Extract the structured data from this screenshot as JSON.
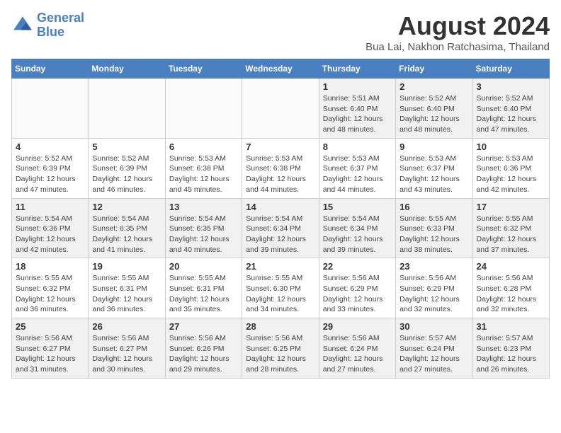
{
  "header": {
    "logo_line1": "General",
    "logo_line2": "Blue",
    "main_title": "August 2024",
    "subtitle": "Bua Lai, Nakhon Ratchasima, Thailand"
  },
  "weekdays": [
    "Sunday",
    "Monday",
    "Tuesday",
    "Wednesday",
    "Thursday",
    "Friday",
    "Saturday"
  ],
  "weeks": [
    [
      {
        "day": "",
        "info": "",
        "empty": true
      },
      {
        "day": "",
        "info": "",
        "empty": true
      },
      {
        "day": "",
        "info": "",
        "empty": true
      },
      {
        "day": "",
        "info": "",
        "empty": true
      },
      {
        "day": "1",
        "info": "Sunrise: 5:51 AM\nSunset: 6:40 PM\nDaylight: 12 hours\nand 48 minutes."
      },
      {
        "day": "2",
        "info": "Sunrise: 5:52 AM\nSunset: 6:40 PM\nDaylight: 12 hours\nand 48 minutes."
      },
      {
        "day": "3",
        "info": "Sunrise: 5:52 AM\nSunset: 6:40 PM\nDaylight: 12 hours\nand 47 minutes."
      }
    ],
    [
      {
        "day": "4",
        "info": "Sunrise: 5:52 AM\nSunset: 6:39 PM\nDaylight: 12 hours\nand 47 minutes."
      },
      {
        "day": "5",
        "info": "Sunrise: 5:52 AM\nSunset: 6:39 PM\nDaylight: 12 hours\nand 46 minutes."
      },
      {
        "day": "6",
        "info": "Sunrise: 5:53 AM\nSunset: 6:38 PM\nDaylight: 12 hours\nand 45 minutes."
      },
      {
        "day": "7",
        "info": "Sunrise: 5:53 AM\nSunset: 6:38 PM\nDaylight: 12 hours\nand 44 minutes."
      },
      {
        "day": "8",
        "info": "Sunrise: 5:53 AM\nSunset: 6:37 PM\nDaylight: 12 hours\nand 44 minutes."
      },
      {
        "day": "9",
        "info": "Sunrise: 5:53 AM\nSunset: 6:37 PM\nDaylight: 12 hours\nand 43 minutes."
      },
      {
        "day": "10",
        "info": "Sunrise: 5:53 AM\nSunset: 6:36 PM\nDaylight: 12 hours\nand 42 minutes."
      }
    ],
    [
      {
        "day": "11",
        "info": "Sunrise: 5:54 AM\nSunset: 6:36 PM\nDaylight: 12 hours\nand 42 minutes."
      },
      {
        "day": "12",
        "info": "Sunrise: 5:54 AM\nSunset: 6:35 PM\nDaylight: 12 hours\nand 41 minutes."
      },
      {
        "day": "13",
        "info": "Sunrise: 5:54 AM\nSunset: 6:35 PM\nDaylight: 12 hours\nand 40 minutes."
      },
      {
        "day": "14",
        "info": "Sunrise: 5:54 AM\nSunset: 6:34 PM\nDaylight: 12 hours\nand 39 minutes."
      },
      {
        "day": "15",
        "info": "Sunrise: 5:54 AM\nSunset: 6:34 PM\nDaylight: 12 hours\nand 39 minutes."
      },
      {
        "day": "16",
        "info": "Sunrise: 5:55 AM\nSunset: 6:33 PM\nDaylight: 12 hours\nand 38 minutes."
      },
      {
        "day": "17",
        "info": "Sunrise: 5:55 AM\nSunset: 6:32 PM\nDaylight: 12 hours\nand 37 minutes."
      }
    ],
    [
      {
        "day": "18",
        "info": "Sunrise: 5:55 AM\nSunset: 6:32 PM\nDaylight: 12 hours\nand 36 minutes."
      },
      {
        "day": "19",
        "info": "Sunrise: 5:55 AM\nSunset: 6:31 PM\nDaylight: 12 hours\nand 36 minutes."
      },
      {
        "day": "20",
        "info": "Sunrise: 5:55 AM\nSunset: 6:31 PM\nDaylight: 12 hours\nand 35 minutes."
      },
      {
        "day": "21",
        "info": "Sunrise: 5:55 AM\nSunset: 6:30 PM\nDaylight: 12 hours\nand 34 minutes."
      },
      {
        "day": "22",
        "info": "Sunrise: 5:56 AM\nSunset: 6:29 PM\nDaylight: 12 hours\nand 33 minutes."
      },
      {
        "day": "23",
        "info": "Sunrise: 5:56 AM\nSunset: 6:29 PM\nDaylight: 12 hours\nand 32 minutes."
      },
      {
        "day": "24",
        "info": "Sunrise: 5:56 AM\nSunset: 6:28 PM\nDaylight: 12 hours\nand 32 minutes."
      }
    ],
    [
      {
        "day": "25",
        "info": "Sunrise: 5:56 AM\nSunset: 6:27 PM\nDaylight: 12 hours\nand 31 minutes."
      },
      {
        "day": "26",
        "info": "Sunrise: 5:56 AM\nSunset: 6:27 PM\nDaylight: 12 hours\nand 30 minutes."
      },
      {
        "day": "27",
        "info": "Sunrise: 5:56 AM\nSunset: 6:26 PM\nDaylight: 12 hours\nand 29 minutes."
      },
      {
        "day": "28",
        "info": "Sunrise: 5:56 AM\nSunset: 6:25 PM\nDaylight: 12 hours\nand 28 minutes."
      },
      {
        "day": "29",
        "info": "Sunrise: 5:56 AM\nSunset: 6:24 PM\nDaylight: 12 hours\nand 27 minutes."
      },
      {
        "day": "30",
        "info": "Sunrise: 5:57 AM\nSunset: 6:24 PM\nDaylight: 12 hours\nand 27 minutes."
      },
      {
        "day": "31",
        "info": "Sunrise: 5:57 AM\nSunset: 6:23 PM\nDaylight: 12 hours\nand 26 minutes."
      }
    ]
  ]
}
